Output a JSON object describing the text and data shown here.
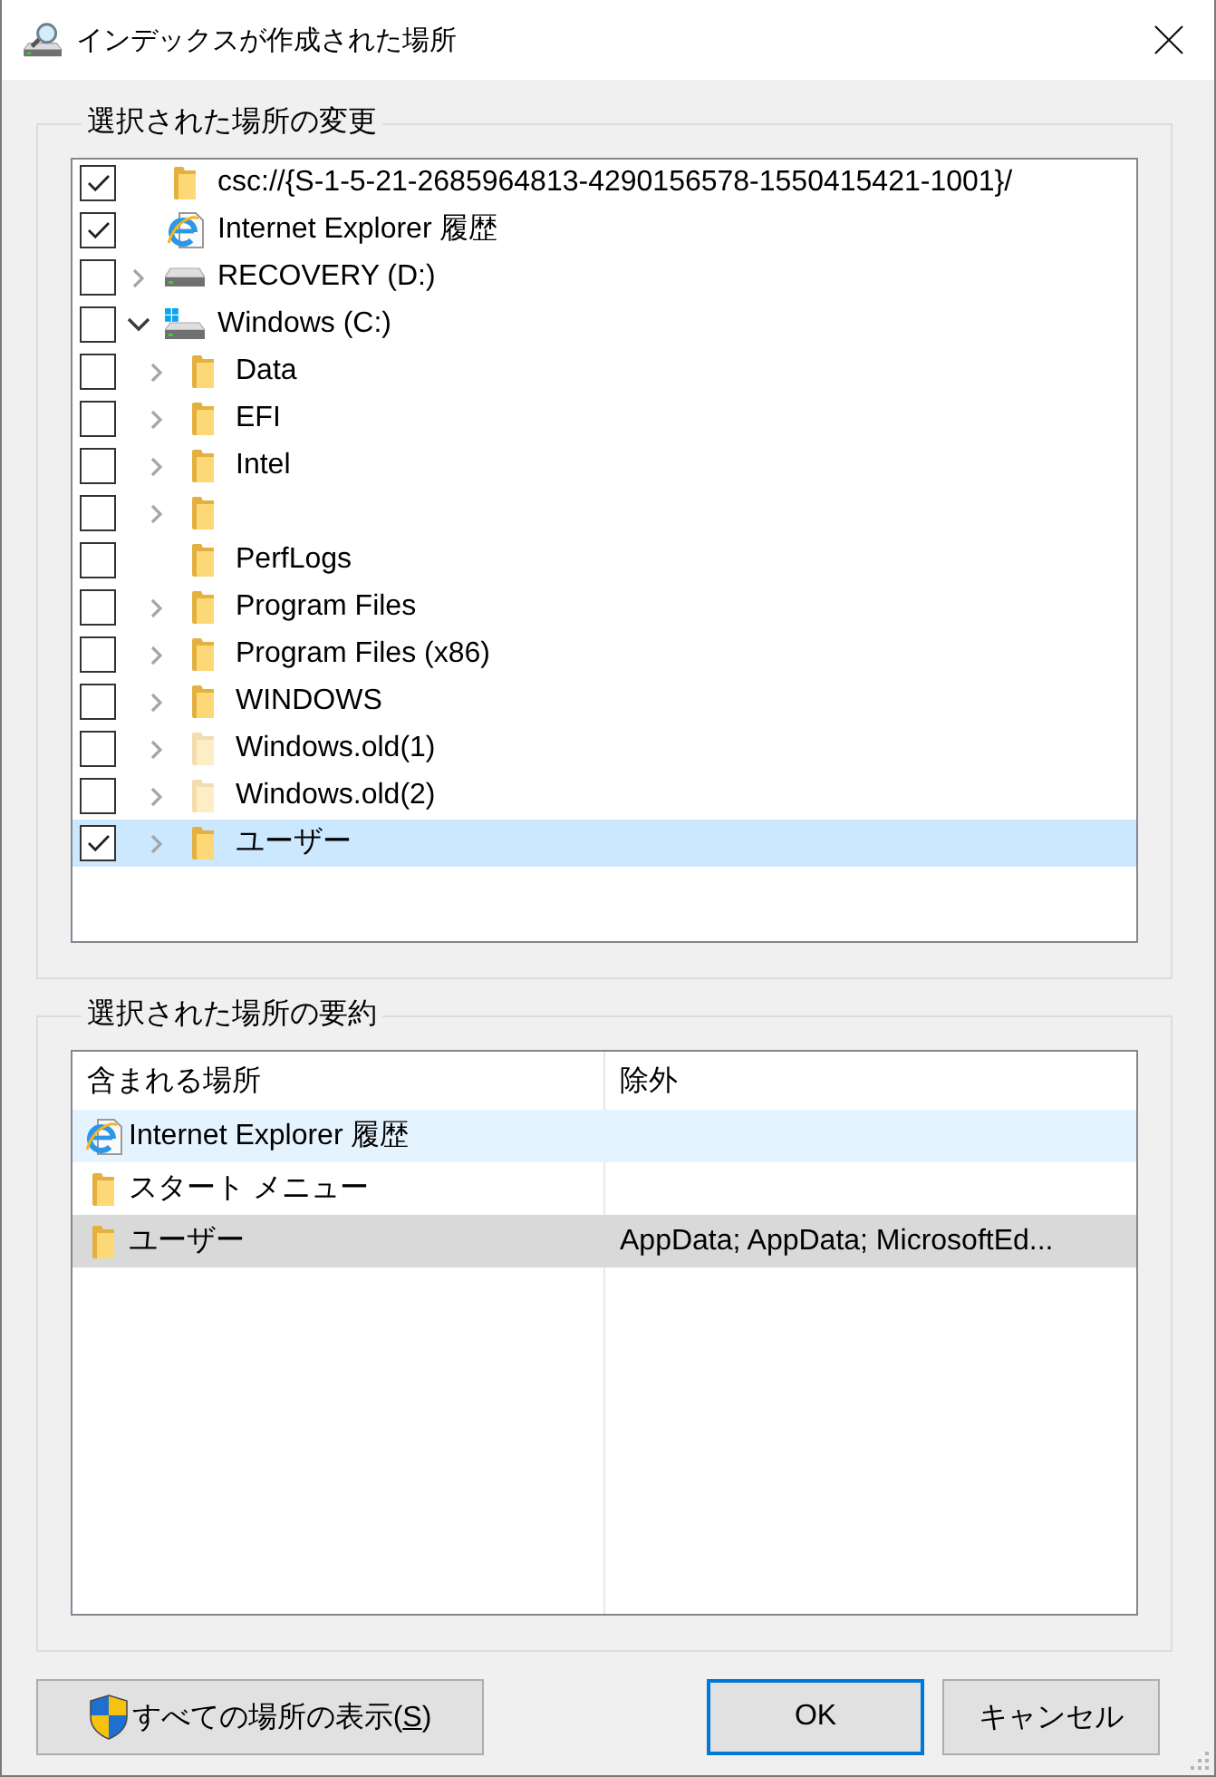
{
  "window": {
    "title": "インデックスが作成された場所"
  },
  "change_group": {
    "legend": "選択された場所の変更",
    "tree": [
      {
        "label": "csc://{S-1-5-21-2685964813-4290156578-1550415421-1001}/",
        "kind": "folder",
        "checked": true,
        "expandable": false,
        "hidden": false,
        "selected": false
      },
      {
        "label": "Internet Explorer 履歴",
        "kind": "browser",
        "checked": true,
        "expandable": false,
        "hidden": false,
        "selected": false
      },
      {
        "label": "RECOVERY (D:)",
        "kind": "drive",
        "checked": false,
        "expandable": true,
        "expanded": false,
        "hidden": false,
        "selected": false
      },
      {
        "label": "Windows (C:)",
        "kind": "windows-drive",
        "checked": false,
        "expandable": true,
        "expanded": true,
        "hidden": false,
        "selected": false,
        "children": [
          {
            "label": "Data",
            "kind": "folder",
            "checked": false,
            "expandable": true,
            "expanded": false,
            "hidden": false,
            "selected": false
          },
          {
            "label": "EFI",
            "kind": "folder",
            "checked": false,
            "expandable": true,
            "expanded": false,
            "hidden": false,
            "selected": false
          },
          {
            "label": "Intel",
            "kind": "folder",
            "checked": false,
            "expandable": true,
            "expanded": false,
            "hidden": false,
            "selected": false
          },
          {
            "kind": "folder",
            "checked": false,
            "expandable": true,
            "expanded": false,
            "hidden": false,
            "selected": false
          },
          {
            "label": "PerfLogs",
            "kind": "folder",
            "checked": false,
            "expandable": false,
            "hidden": false,
            "selected": false
          },
          {
            "label": "Program Files",
            "kind": "folder",
            "checked": false,
            "expandable": true,
            "expanded": false,
            "hidden": false,
            "selected": false
          },
          {
            "label": "Program Files (x86)",
            "kind": "folder",
            "checked": false,
            "expandable": true,
            "expanded": false,
            "hidden": false,
            "selected": false
          },
          {
            "label": "WINDOWS",
            "kind": "folder",
            "checked": false,
            "expandable": true,
            "expanded": false,
            "hidden": false,
            "selected": false
          },
          {
            "label": "Windows.old(1)",
            "kind": "folder",
            "checked": false,
            "expandable": true,
            "expanded": false,
            "hidden": true,
            "selected": false
          },
          {
            "label": "Windows.old(2)",
            "kind": "folder",
            "checked": false,
            "expandable": true,
            "expanded": false,
            "hidden": true,
            "selected": false
          },
          {
            "label": "ユーザー",
            "kind": "folder",
            "checked": true,
            "expandable": true,
            "expanded": false,
            "hidden": false,
            "selected": true
          }
        ]
      }
    ]
  },
  "summary_group": {
    "legend": "選択された場所の要約",
    "columns": [
      "含まれる場所",
      "除外"
    ],
    "rows": [
      {
        "kind": "browser",
        "location": "Internet Explorer 履歴",
        "hovered": true,
        "selected": false
      },
      {
        "kind": "folder",
        "location": "スタート メニュー",
        "hovered": false,
        "selected": false
      },
      {
        "kind": "folder",
        "location": "ユーザー",
        "exclusions": "AppData; AppData; MicrosoftEd...",
        "hovered": false,
        "selected": true
      }
    ]
  },
  "buttons": {
    "left": [
      {
        "parts": [
          {
            "text": "すべての場所の表示(",
            "underlined": false
          },
          {
            "text": "S",
            "underlined": true
          },
          {
            "text": ")",
            "underlined": false
          }
        ],
        "shield": true,
        "default": false
      }
    ],
    "right": [
      {
        "parts": [
          {
            "text": "OK",
            "underlined": false
          }
        ],
        "shield": false,
        "default": true
      },
      {
        "parts": [
          {
            "text": "キャンセル",
            "underlined": false
          }
        ],
        "shield": false,
        "default": false
      }
    ]
  }
}
